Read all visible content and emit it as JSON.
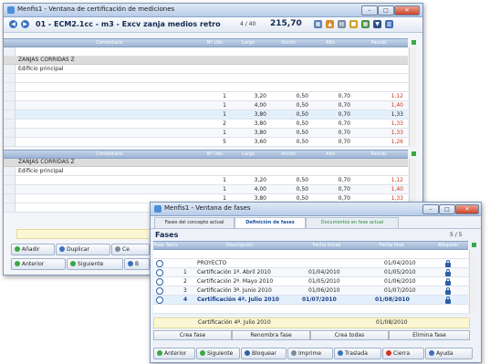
{
  "window1": {
    "title": "Menfis1 - Ventana de certificación de mediciones",
    "controls": {
      "minimize": "–",
      "maximize": "□",
      "close": "✕"
    },
    "header": {
      "title": "01 - ECM2.1cc - m3 - Excv zanja medios retro",
      "count": "4 / 40",
      "total": "215,70"
    },
    "columns": [
      "Comentario",
      "Nº Uds.",
      "Largo",
      "Ancho",
      "Alto",
      "Parcial"
    ],
    "table1": {
      "section": "ZANJAS CORRIDAS Z",
      "subsection": "Edificio principal",
      "rows": [
        {
          "uds": "1",
          "largo": "3,20",
          "ancho": "0,50",
          "alto": "0,70",
          "parcial": "1,12"
        },
        {
          "uds": "1",
          "largo": "4,00",
          "ancho": "0,50",
          "alto": "0,70",
          "parcial": "1,40"
        },
        {
          "uds": "1",
          "largo": "3,80",
          "ancho": "0,50",
          "alto": "0,70",
          "parcial": "1,33"
        },
        {
          "uds": "2",
          "largo": "3,80",
          "ancho": "0,50",
          "alto": "0,70",
          "parcial": "1,33"
        },
        {
          "uds": "1",
          "largo": "3,80",
          "ancho": "0,50",
          "alto": "0,70",
          "parcial": "1,33"
        },
        {
          "uds": "5",
          "largo": "3,60",
          "ancho": "0,50",
          "alto": "0,70",
          "parcial": "1,26"
        }
      ]
    },
    "table2": {
      "section": "ZANJAS CORRIDAS Z",
      "subsection": "Edificio principal",
      "rows": [
        {
          "uds": "1",
          "largo": "3,20",
          "ancho": "0,50",
          "alto": "0,70",
          "parcial": "1,12"
        },
        {
          "uds": "1",
          "largo": "4,00",
          "ancho": "0,50",
          "alto": "0,70",
          "parcial": "1,40"
        },
        {
          "uds": "1",
          "largo": "3,80",
          "ancho": "0,50",
          "alto": "0,70",
          "parcial": "1,33"
        }
      ]
    },
    "toolbar": {
      "anadir": "Añadir",
      "duplicar": "Duplicar",
      "ce": "Ce"
    },
    "footer": {
      "anterior": "Anterior",
      "siguiente": "Siguiente",
      "b": "B"
    }
  },
  "window2": {
    "title": "Menfis1 - Ventana de fases",
    "tabs": [
      "Fases del concepto actual",
      "Definición de fases",
      "Documentos en fase actual"
    ],
    "section_title": "Fases",
    "count": "5 / 5",
    "columns": [
      "Fase",
      "Núm.",
      "Descripción",
      "Fecha inicial",
      "Fecha final",
      "Bloquear"
    ],
    "rows": [
      {
        "num": "",
        "desc": "PROYECTO",
        "fini": "",
        "ffin": "01/04/2010",
        "locked": true
      },
      {
        "num": "1",
        "desc": "Certificación 1ª. Abril 2010",
        "fini": "01/04/2010",
        "ffin": "01/05/2010",
        "locked": true
      },
      {
        "num": "2",
        "desc": "Certificación 2ª. Mayo 2010",
        "fini": "01/05/2010",
        "ffin": "01/06/2010",
        "locked": true
      },
      {
        "num": "3",
        "desc": "Certificación 3ª. Junio 2010",
        "fini": "01/06/2010",
        "ffin": "01/07/2010",
        "locked": true
      },
      {
        "num": "4",
        "desc": "Certificación 4ª. Julio 2010",
        "fini": "01/07/2010",
        "ffin": "01/08/2010",
        "locked": false
      }
    ],
    "edit_row": {
      "desc": "Certificación 4ª. Julio 2010",
      "date": "01/08/2010"
    },
    "actions": [
      "Crea fase",
      "Renombra fase",
      "Crea todas",
      "Elimina fase"
    ],
    "footer": {
      "anterior": "Anterior",
      "siguiente": "Siguiente",
      "bloquear": "Bloquear",
      "imprime": "Imprime",
      "traslada": "Traslada",
      "cierra": "Cierra",
      "ayuda": "Ayuda"
    }
  },
  "colors": {
    "accent": "#2d5fa8",
    "red_value": "#d6321e",
    "header_blue": "#9cb4d3"
  }
}
